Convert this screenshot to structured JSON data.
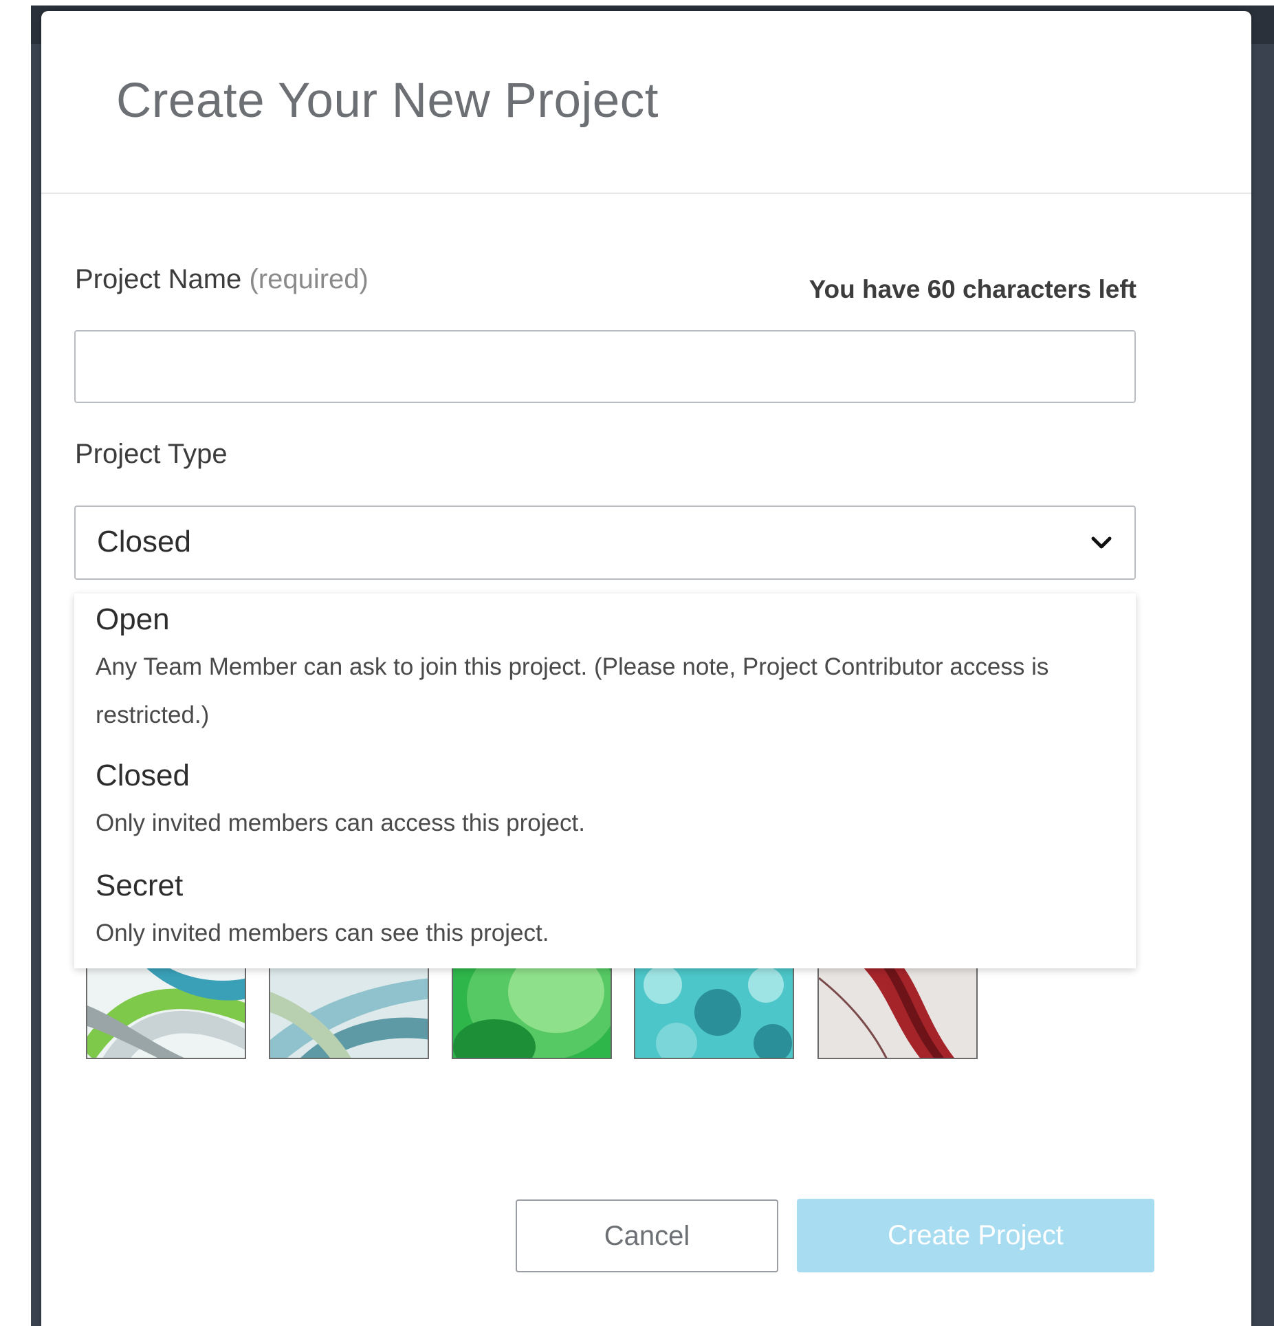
{
  "dialog": {
    "title": "Create Your New Project"
  },
  "project_name": {
    "label": "Project Name",
    "required_text": "(required)",
    "char_count": "You have 60 characters left",
    "value": "",
    "placeholder": ""
  },
  "project_type": {
    "label": "Project Type",
    "selected": "Closed",
    "options": [
      {
        "title": "Open",
        "description": "Any Team Member can ask to join this project. (Please note, Project Contributor access is restricted.)"
      },
      {
        "title": "Closed",
        "description": "Only invited members can access this project."
      },
      {
        "title": "Secret",
        "description": "Only invited members can see this project."
      }
    ]
  },
  "thumbnails": [
    {
      "name": "green-silver-ribbons",
      "colors": [
        "#7ec84a",
        "#c9d3d6",
        "#3aa0b8"
      ]
    },
    {
      "name": "teal-glass-ribbons",
      "colors": [
        "#8fc2cc",
        "#e2eef0",
        "#5d9aa6"
      ]
    },
    {
      "name": "green-swirl",
      "colors": [
        "#2fb64a",
        "#8fe08a",
        "#1d8f37"
      ]
    },
    {
      "name": "cyan-cells",
      "colors": [
        "#4cc6c8",
        "#9fe4e4",
        "#2a8f98"
      ]
    },
    {
      "name": "red-twist",
      "colors": [
        "#a5242a",
        "#d8d2cf",
        "#6e1418"
      ]
    }
  ],
  "buttons": {
    "cancel": "Cancel",
    "create": "Create Project"
  },
  "colors": {
    "primary_disabled": "#a7dcf1",
    "backdrop": "#3a4250"
  }
}
